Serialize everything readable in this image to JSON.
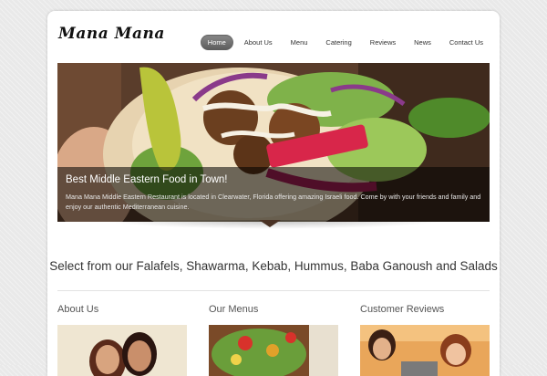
{
  "site": {
    "logo": "Mana Mana"
  },
  "nav": {
    "items": [
      {
        "label": "Home",
        "active": true
      },
      {
        "label": "About Us",
        "active": false
      },
      {
        "label": "Menu",
        "active": false
      },
      {
        "label": "Catering",
        "active": false
      },
      {
        "label": "Reviews",
        "active": false
      },
      {
        "label": "News",
        "active": false
      },
      {
        "label": "Contact Us",
        "active": false
      }
    ]
  },
  "hero": {
    "title": "Best Middle Eastern Food in Town!",
    "text": "Mana Mana Middle Eastern Restaurant is located in Clearwater, Florida offering amazing Israeli food. Come by with your friends and family and enjoy our authentic Mediterranean cuisine."
  },
  "tagline": "Select from our Falafels, Shawarma, Kebab, Hummus, Baba Ganoush and Salads",
  "columns": [
    {
      "title": "About Us"
    },
    {
      "title": "Our Menus"
    },
    {
      "title": "Customer Reviews"
    }
  ],
  "colors": {
    "background": "#e9e9e9",
    "nav_active": "#6e6e6e",
    "caption_bg": "rgba(0,0,0,0.55)"
  }
}
